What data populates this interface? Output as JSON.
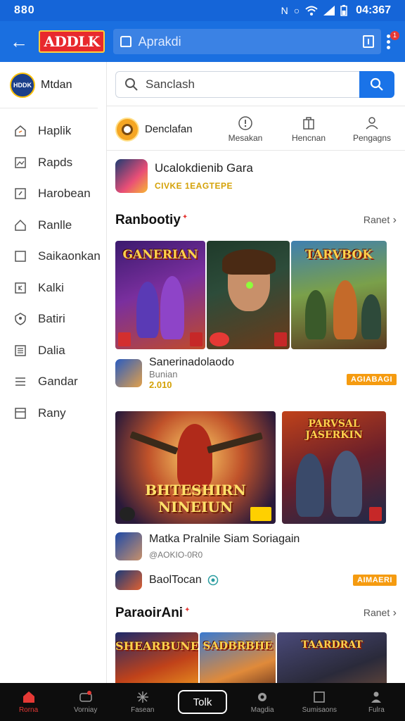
{
  "status_bar": {
    "left_time": "880",
    "clock": "04:367"
  },
  "app_bar": {
    "logo_text": "ADDLK",
    "search_placeholder": "Aprakdi",
    "notification_count": "1"
  },
  "sidebar": {
    "profile_name": "Mtdan",
    "avatar_text": "HDDK",
    "items": [
      {
        "label": "Haplik",
        "icon": "home-icon"
      },
      {
        "label": "Rapds",
        "icon": "image-icon"
      },
      {
        "label": "Harobean",
        "icon": "edit-box-icon"
      },
      {
        "label": "Ranlle",
        "icon": "house-icon"
      },
      {
        "label": "Saikaonkan",
        "icon": "square-icon"
      },
      {
        "label": "Kalki",
        "icon": "grid-icon"
      },
      {
        "label": "Batiri",
        "icon": "shield-icon"
      },
      {
        "label": "Dalia",
        "icon": "list-icon"
      },
      {
        "label": "Gandar",
        "icon": "menu-icon"
      },
      {
        "label": "Rany",
        "icon": "window-icon"
      }
    ]
  },
  "main": {
    "search_placeholder": "Sanclash",
    "categories": {
      "primary": "Denclafan",
      "tabs": [
        "Mesakan",
        "Hencnan",
        "Pengagns"
      ]
    },
    "featured": {
      "title": "Ucalokdienib Gara",
      "subtitle": "CIVKE 1EAGTEPE"
    },
    "section1": {
      "title": "Ranbootiy",
      "more": "Ranet",
      "tiles": [
        "GANERIAN",
        "",
        "TARVBOK"
      ],
      "app": {
        "name": "Sanerinadolaodo",
        "sub1": "Bunian",
        "sub2": "2.010",
        "tag": "AGIABAGI"
      }
    },
    "section2": {
      "tiles": [
        "BHTESHIRN NINEIUN",
        "PARVSAL JASERKIN"
      ],
      "apps": [
        {
          "name": "Matka Pralnile Siam Soriagain",
          "sub": "@AOKIO-0R0",
          "tag": ""
        },
        {
          "name": "BaolTocan",
          "sub": "",
          "tag": "AIMAERI"
        }
      ]
    },
    "section3": {
      "title": "ParaoirAni",
      "more": "Ranet",
      "tiles": [
        "SHEARBUNE",
        "SADBRBHE",
        "TAARDRAT"
      ]
    }
  },
  "bottom_nav": {
    "items": [
      "Rorna",
      "Vorniay",
      "Fasean",
      "Tolk",
      "Magdia",
      "Sumisaons",
      "Fulra"
    ],
    "active": "Rorna"
  },
  "colors": {
    "primary": "#1a6fe0",
    "accent": "#f59b10",
    "active_nav": "#e53935"
  }
}
